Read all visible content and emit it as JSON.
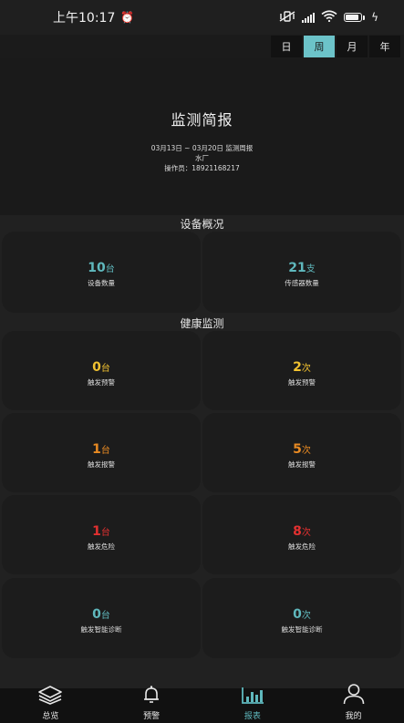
{
  "status_bar": {
    "time": "上午10:17",
    "colors": {
      "text": "#f2f2f2"
    }
  },
  "period_tabs": [
    {
      "label": "日",
      "active": false
    },
    {
      "label": "周",
      "active": true
    },
    {
      "label": "月",
      "active": false
    },
    {
      "label": "年",
      "active": false
    }
  ],
  "report": {
    "title": "监测简报",
    "date_range": "03月13日 ~ 03月20日 监测周报",
    "site": "水厂",
    "operator": "操作员：18921168217"
  },
  "device_overview": {
    "section_title": "设备概况",
    "cards": [
      {
        "value": "10",
        "unit": "台",
        "label": "设备数量"
      },
      {
        "value": "21",
        "unit": "支",
        "label": "传感器数量"
      }
    ]
  },
  "health_monitoring": {
    "section_title": "健康监测",
    "cards": [
      {
        "value": "0",
        "unit": "台",
        "label": "触发预警"
      },
      {
        "value": "2",
        "unit": "次",
        "label": "触发预警"
      },
      {
        "value": "1",
        "unit": "台",
        "label": "触发报警"
      },
      {
        "value": "5",
        "unit": "次",
        "label": "触发报警"
      },
      {
        "value": "1",
        "unit": "台",
        "label": "触发危险"
      },
      {
        "value": "8",
        "unit": "次",
        "label": "触发危险"
      },
      {
        "value": "0",
        "unit": "台",
        "label": "触发智能诊断"
      },
      {
        "value": "0",
        "unit": "次",
        "label": "触发智能诊断"
      }
    ]
  },
  "bottom_nav": [
    {
      "label": "总览",
      "icon": "layers-icon",
      "active": false
    },
    {
      "label": "预警",
      "icon": "bell-icon",
      "active": false
    },
    {
      "label": "报表",
      "icon": "bar-chart-icon",
      "active": true
    },
    {
      "label": "我的",
      "icon": "user-icon",
      "active": false
    }
  ],
  "colors": {
    "background": "#212121",
    "card": "#1c1c1c",
    "accent": "#5fb8bd",
    "tab_active": "#6cc3c9",
    "warning": "#f2c230",
    "alarm": "#e88a22",
    "danger": "#e23030"
  }
}
